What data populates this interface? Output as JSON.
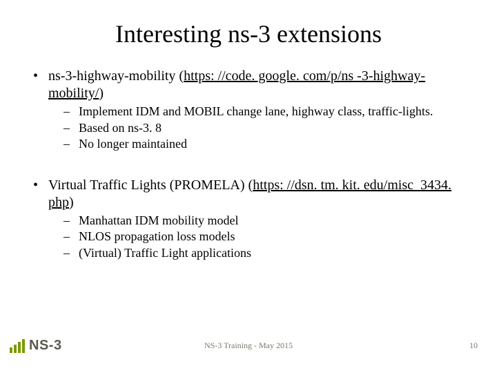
{
  "title": "Interesting ns-3 extensions",
  "items": [
    {
      "lead": "ns-3-highway-mobility (",
      "link": "https: //code. google. com/p/ns -3-highway-mobility/",
      "tail": ")",
      "subs": [
        "Implement IDM and MOBIL change lane, highway class, traffic-lights.",
        "Based on ns-3. 8",
        "No longer maintained"
      ]
    },
    {
      "lead": "Virtual Traffic Lights (PROMELA) (",
      "link": "https: //dsn. tm. kit. edu/misc_3434. php",
      "tail": ")",
      "subs": [
        "Manhattan IDM mobility model",
        "NLOS propagation loss models",
        "(Virtual) Traffic Light applications"
      ]
    }
  ],
  "footer": {
    "center": "NS-3 Training - May 2015",
    "page": "10",
    "logo_text": "NS-3"
  },
  "glyphs": {
    "bullet": "•",
    "dash": "–"
  }
}
